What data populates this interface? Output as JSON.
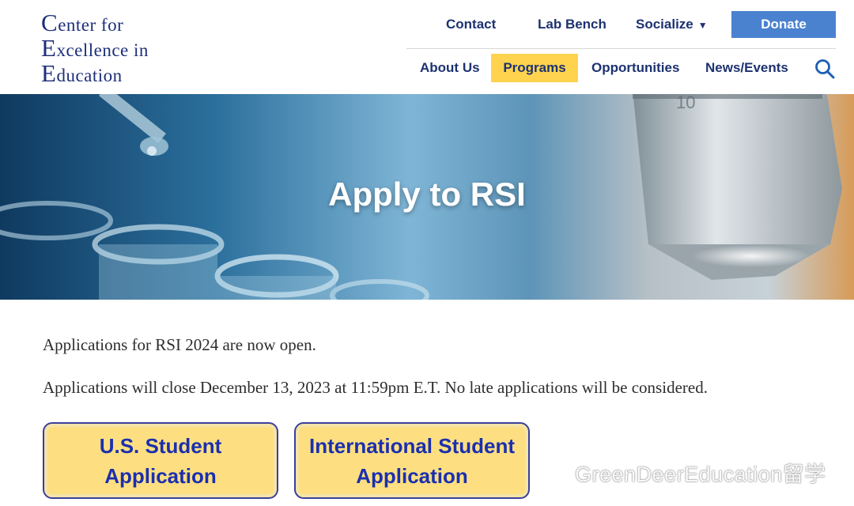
{
  "logo": {
    "line1_cap": "C",
    "line1_rest": "enter for",
    "line2_cap": "E",
    "line2_rest": "xcellence in",
    "line3_cap": "E",
    "line3_rest": "ducation"
  },
  "top_nav": {
    "contact": "Contact",
    "lab_bench": "Lab Bench",
    "socialize": "Socialize",
    "donate": "Donate"
  },
  "main_nav": {
    "about": "About Us",
    "programs": "Programs",
    "opportunities": "Opportunities",
    "news": "News/Events",
    "active": "Programs"
  },
  "hero": {
    "title": "Apply to RSI"
  },
  "content": {
    "p1": "Applications for RSI 2024 are now open.",
    "p2": "Applications will close December 13, 2023 at 11:59pm E.T.  No late applications will be considered."
  },
  "buttons": {
    "us_line1": "U.S. Student",
    "us_line2": "Application",
    "intl_line1": "International Student",
    "intl_line2": "Application"
  },
  "watermark": {
    "text": "GreenDeerEducation留学"
  },
  "colors": {
    "navy": "#1d3270",
    "donate_blue": "#4a82cf",
    "active_nav": "#ffd34e",
    "button_fill": "#fddf82",
    "button_border": "#3a3f9b"
  },
  "icons": [
    "search-icon",
    "caret-down-icon",
    "wechat-icon"
  ]
}
